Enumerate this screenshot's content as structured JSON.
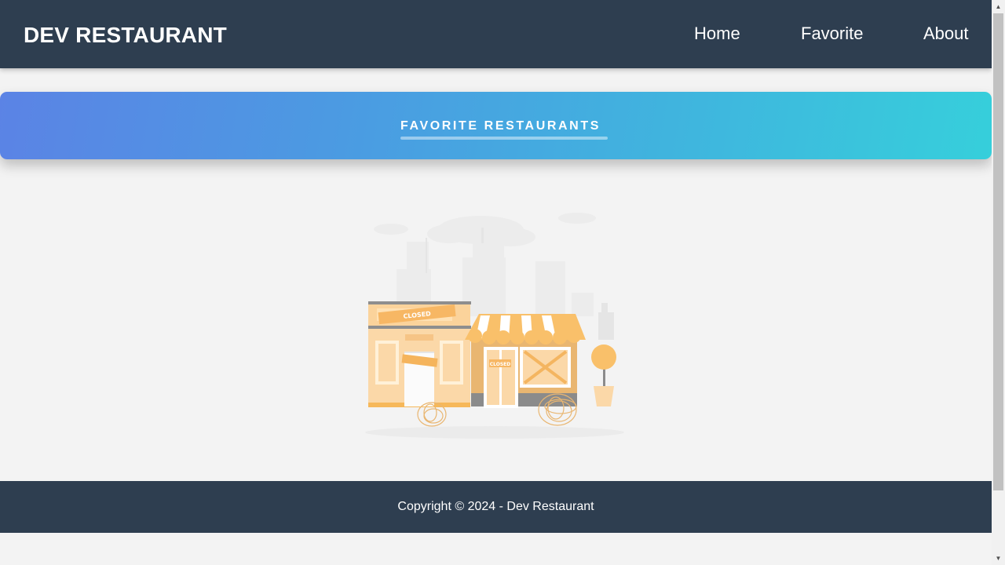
{
  "header": {
    "brand": "DEV RESTAURANT",
    "nav": [
      {
        "label": "Home"
      },
      {
        "label": "Favorite"
      },
      {
        "label": "About"
      }
    ]
  },
  "hero": {
    "title": "FAVORITE RESTAURANTS"
  },
  "empty_state": {
    "illustration": "closed-stores-icon",
    "signs": [
      "CLOSED",
      "CLOSED"
    ]
  },
  "footer": {
    "copyright": "Copyright © 2024 - Dev Restaurant"
  },
  "colors": {
    "navbar": "#2e3e50",
    "hero_start": "#5b83e5",
    "hero_end": "#36cfdb",
    "illustration_orange": "#f9c06a",
    "background": "#f3f3f3"
  }
}
